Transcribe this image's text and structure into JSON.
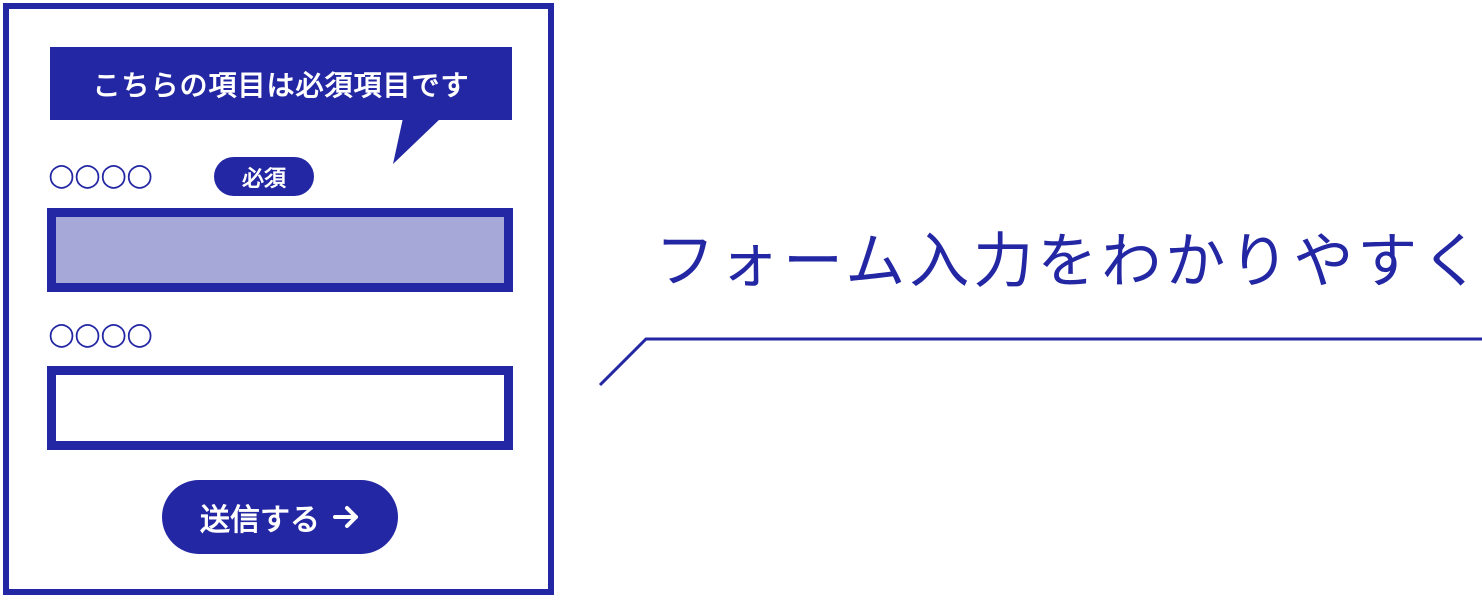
{
  "form": {
    "tooltip_text": "こちらの項目は必須項目です",
    "field1_label": "○○○○",
    "required_badge": "必須",
    "field2_label": "○○○○",
    "submit_label": "送信する"
  },
  "headline": "フォーム入力をわかりやすく",
  "colors": {
    "accent": "#2327a3",
    "input_highlight": "#a6a8d8",
    "background": "#ffffff"
  },
  "icons": {
    "submit_arrow": "arrow-right-icon"
  }
}
